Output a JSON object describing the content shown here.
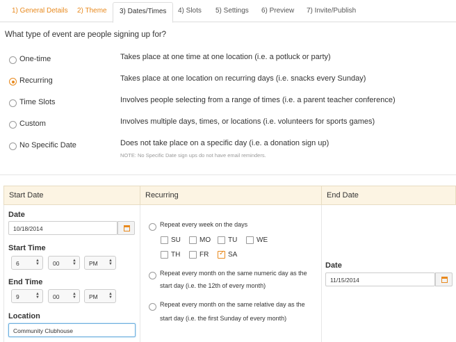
{
  "tabs": [
    {
      "label": "1) General Details",
      "state": "done"
    },
    {
      "label": "2) Theme",
      "state": "done"
    },
    {
      "label": "3) Dates/Times",
      "state": "active"
    },
    {
      "label": "4) Slots",
      "state": "todo"
    },
    {
      "label": "5) Settings",
      "state": "todo"
    },
    {
      "label": "6) Preview",
      "state": "todo"
    },
    {
      "label": "7) Invite/Publish",
      "state": "todo"
    }
  ],
  "question": "What type of event are people signing up for?",
  "event_types": [
    {
      "label": "One-time",
      "desc": "Takes place at one time at one location (i.e. a potluck or party)",
      "checked": false
    },
    {
      "label": "Recurring",
      "desc": "Takes place at one location on recurring days (i.e. snacks every Sunday)",
      "checked": true
    },
    {
      "label": "Time Slots",
      "desc": "Involves people selecting from a range of times (i.e. a parent teacher conference)",
      "checked": false
    },
    {
      "label": "Custom",
      "desc": "Involves multiple days, times, or locations (i.e. volunteers for sports games)",
      "checked": false
    },
    {
      "label": "No Specific Date",
      "desc": "Does not take place on a specific day (i.e. a donation sign up)",
      "checked": false
    }
  ],
  "note": "NOTE: No Specific Date sign ups do not have email reminders.",
  "columns": {
    "start": "Start Date",
    "recurring": "Recurring",
    "end": "End Date"
  },
  "start": {
    "date_label": "Date",
    "date_value": "10/18/2014",
    "start_time_label": "Start Time",
    "start_hour": "6",
    "start_minute": "00",
    "start_ampm": "PM",
    "end_time_label": "End Time",
    "end_hour": "9",
    "end_minute": "00",
    "end_ampm": "PM",
    "location_label": "Location",
    "location_value": "Community Clubhouse"
  },
  "recurring": {
    "weekly_label": "Repeat every week on the days",
    "days": [
      {
        "label": "SU",
        "checked": false
      },
      {
        "label": "MO",
        "checked": false
      },
      {
        "label": "TU",
        "checked": false
      },
      {
        "label": "WE",
        "checked": false
      },
      {
        "label": "TH",
        "checked": false
      },
      {
        "label": "FR",
        "checked": false
      },
      {
        "label": "SA",
        "checked": true
      }
    ],
    "monthly_numeric_line1": "Repeat every month on the same numeric day as the",
    "monthly_numeric_line2": "start day (i.e. the 12th of every month)",
    "monthly_relative_line1": "Repeat every month on the same relative day as the",
    "monthly_relative_line2": "start day (i.e. the first Sunday of every month)"
  },
  "end": {
    "date_label": "Date",
    "date_value": "11/15/2014"
  },
  "colors": {
    "accent": "#e8891d",
    "header_bg": "#fcf4e3"
  }
}
